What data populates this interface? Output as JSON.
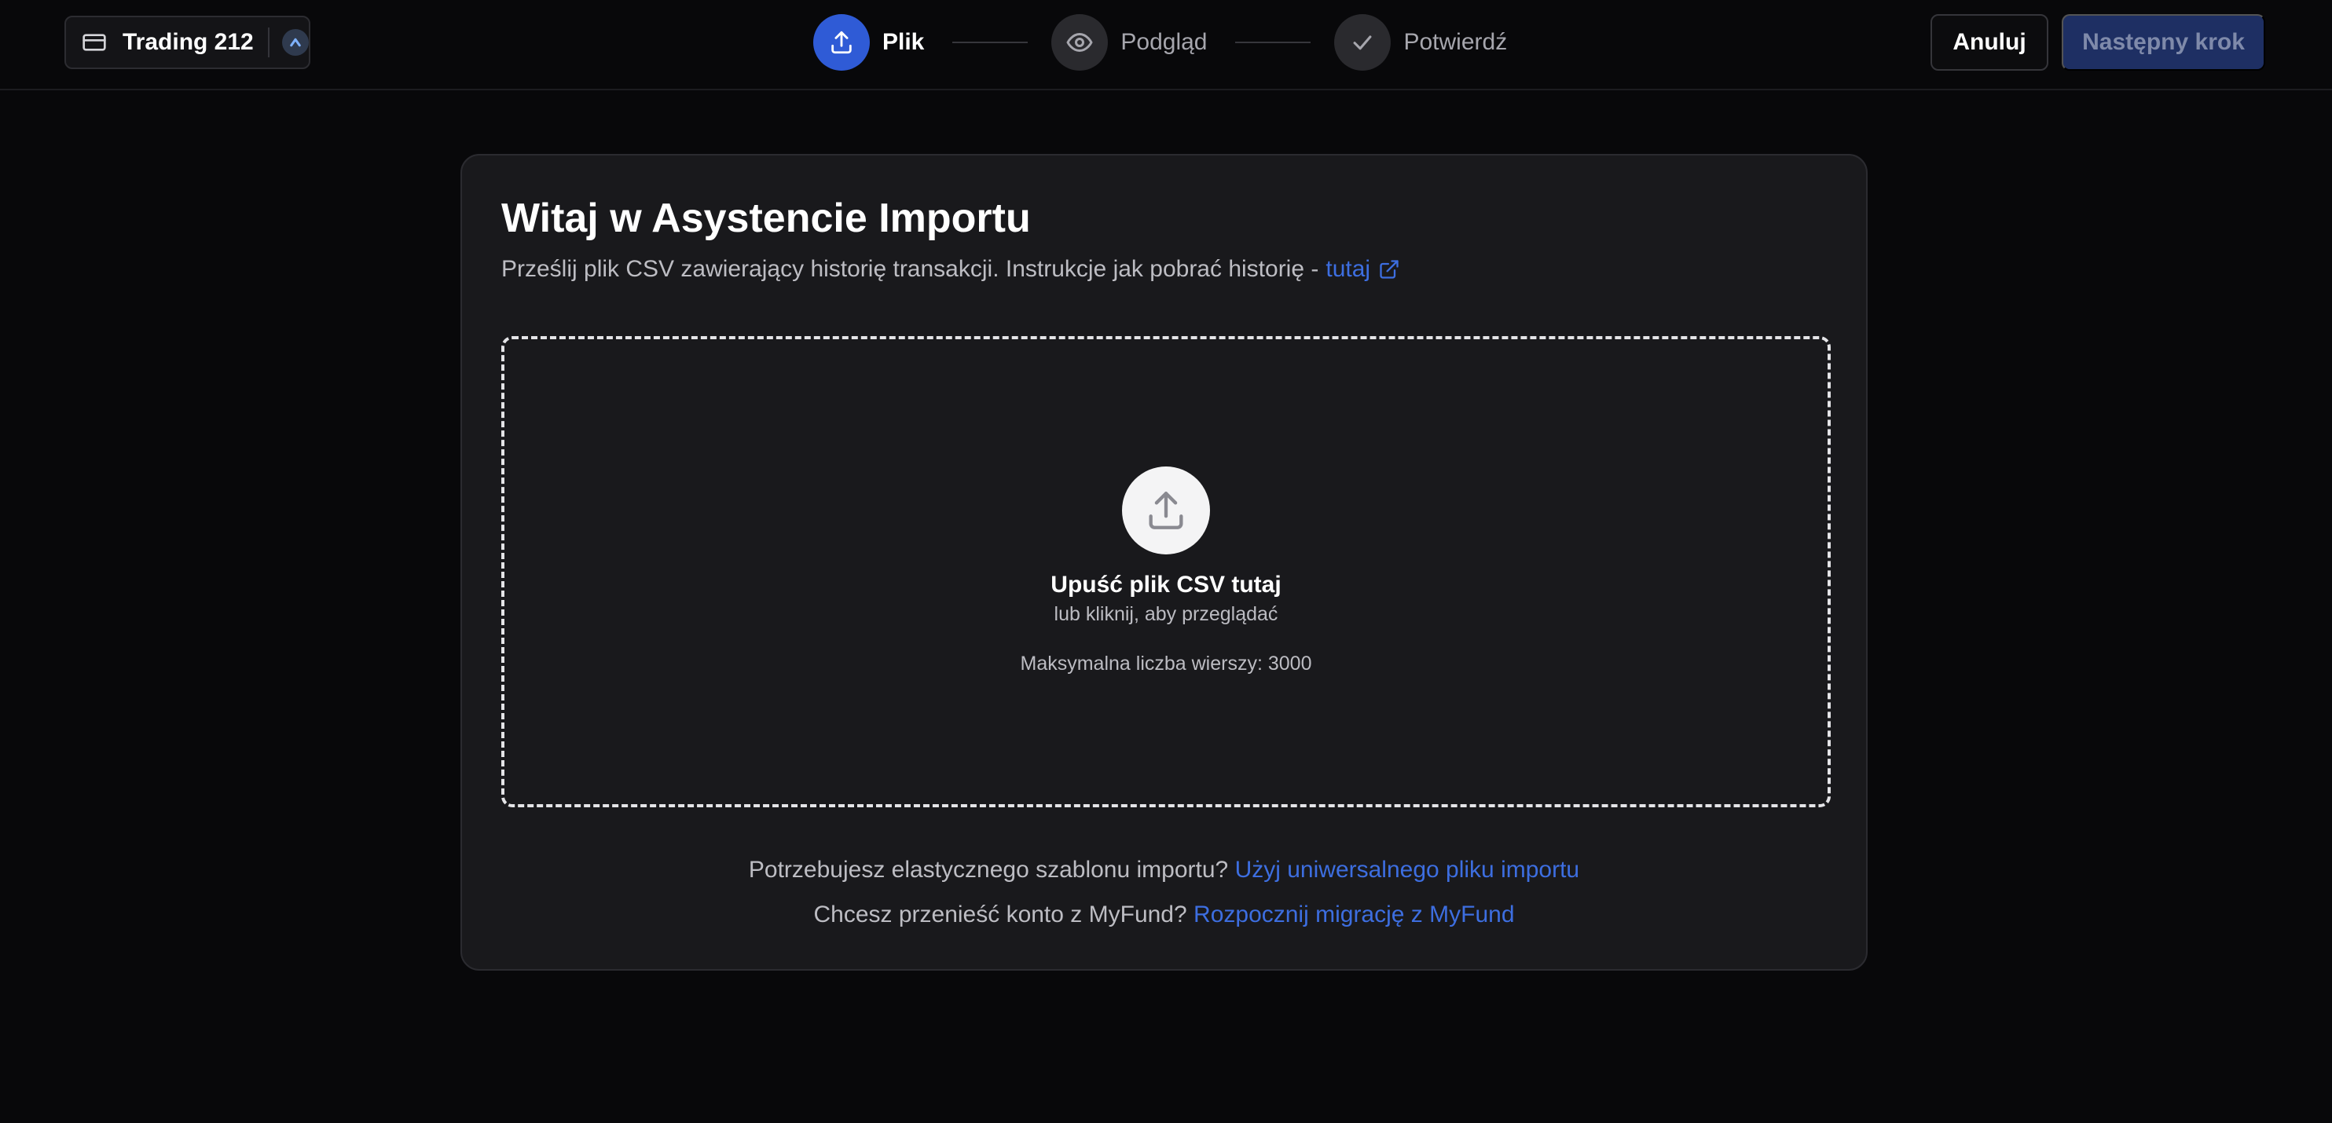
{
  "header": {
    "account": {
      "name": "Trading 212",
      "card_icon": "credit-card-icon",
      "broker_icon": "trading212-logo"
    },
    "steps": [
      {
        "label": "Plik",
        "icon": "upload-icon",
        "active": true
      },
      {
        "label": "Podgląd",
        "icon": "eye-icon",
        "active": false
      },
      {
        "label": "Potwierdź",
        "icon": "check-icon",
        "active": false
      }
    ],
    "cancel_label": "Anuluj",
    "next_label": "Następny krok"
  },
  "main": {
    "title": "Witaj w Asystencie Importu",
    "subtitle_text": "Prześlij plik CSV zawierający historię transakcji. Instrukcje jak pobrać historię -",
    "subtitle_link": "tutaj",
    "dropzone": {
      "icon": "upload-icon",
      "title": "Upuść plik CSV tutaj",
      "subtitle": "lub kliknij, aby przeglądać",
      "max_rows": "Maksymalna liczba wierszy: 3000"
    },
    "footer": {
      "template_question": "Potrzebujesz elastycznego szablonu importu?",
      "template_link": "Użyj uniwersalnego pliku importu",
      "migration_question": "Chcesz przenieść konto z MyFund?",
      "migration_link": "Rozpocznij migrację z MyFund"
    }
  },
  "colors": {
    "background": "#08080a",
    "panel": "#19191c",
    "accent": "#2f5bd6",
    "link": "#3d6ee0",
    "next_button": "#1e2f63"
  }
}
